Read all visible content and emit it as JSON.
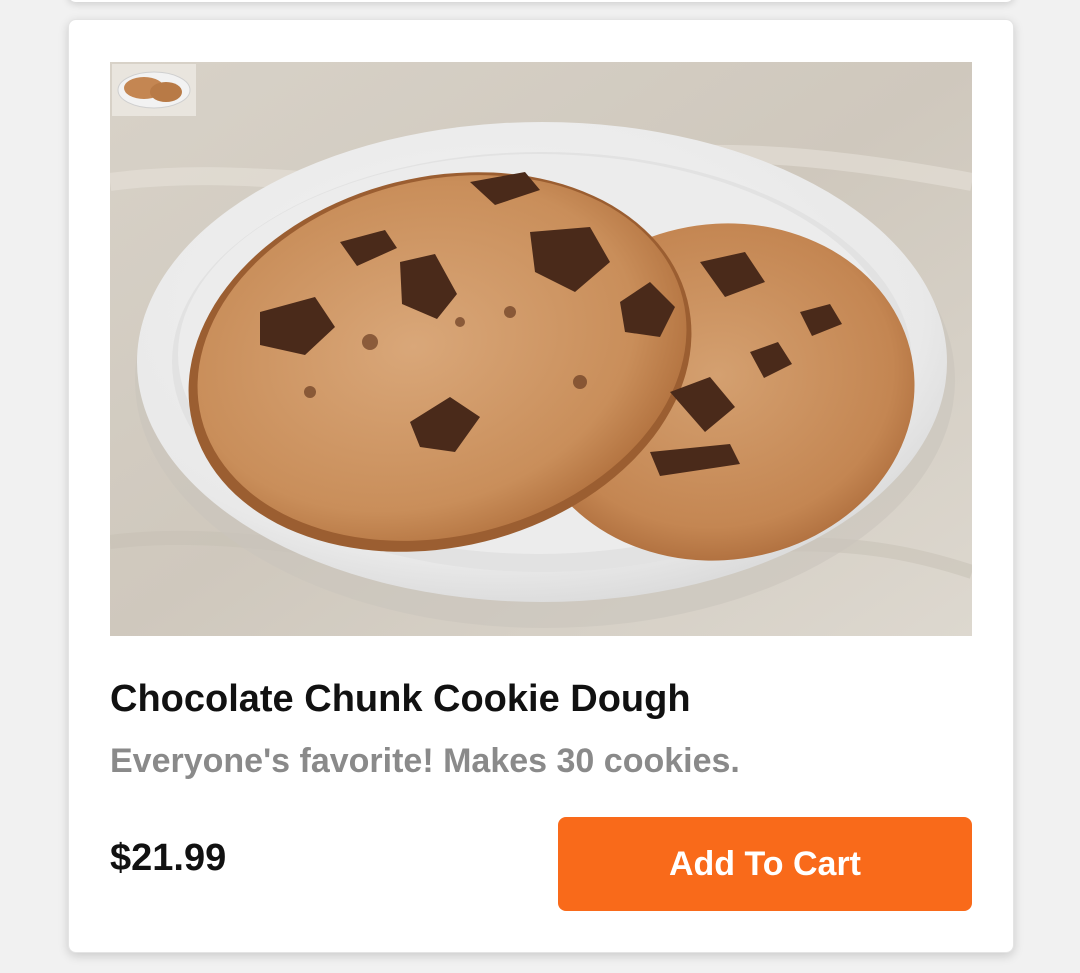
{
  "product": {
    "name": "Chocolate Chunk Cookie Dough",
    "description": "Everyone's favorite! Makes 30 cookies.",
    "price": "$21.99",
    "image_alt": "Two chocolate chunk cookies on a white plate"
  },
  "actions": {
    "add_to_cart_label": "Add To Cart"
  },
  "colors": {
    "accent": "#f96a1a",
    "title_text": "#111111",
    "description_text": "#8a8a8a"
  }
}
